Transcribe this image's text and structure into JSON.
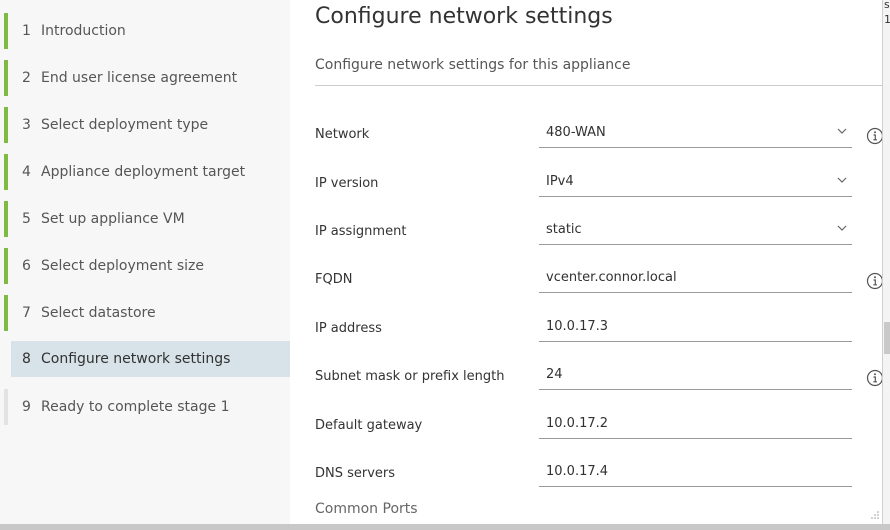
{
  "steps": [
    {
      "num": "1",
      "label": "Introduction",
      "state": "done"
    },
    {
      "num": "2",
      "label": "End user license agreement",
      "state": "done"
    },
    {
      "num": "3",
      "label": "Select deployment type",
      "state": "done"
    },
    {
      "num": "4",
      "label": "Appliance deployment target",
      "state": "done"
    },
    {
      "num": "5",
      "label": "Set up appliance VM",
      "state": "done"
    },
    {
      "num": "6",
      "label": "Select deployment size",
      "state": "done"
    },
    {
      "num": "7",
      "label": "Select datastore",
      "state": "done"
    },
    {
      "num": "8",
      "label": "Configure network settings",
      "state": "active"
    },
    {
      "num": "9",
      "label": "Ready to complete stage 1",
      "state": "todo"
    }
  ],
  "main": {
    "title": "Configure network settings",
    "subtitle": "Configure network settings for this appliance",
    "common_ports": "Common Ports"
  },
  "form": {
    "network": {
      "label": "Network",
      "value": "480-WAN"
    },
    "ip_version": {
      "label": "IP version",
      "value": "IPv4"
    },
    "ip_assignment": {
      "label": "IP assignment",
      "value": "static"
    },
    "fqdn": {
      "label": "FQDN",
      "value": "vcenter.connor.local"
    },
    "ip_address": {
      "label": "IP address",
      "value": "10.0.17.3"
    },
    "subnet": {
      "label": "Subnet mask or prefix length",
      "value": "24"
    },
    "gateway": {
      "label": "Default gateway",
      "value": "10.0.17.2"
    },
    "dns": {
      "label": "DNS servers",
      "value": "10.0.17.4"
    }
  },
  "right_edge": {
    "t1": "s",
    "t2": "1"
  },
  "colors": {
    "done_bar": "#7fba42",
    "active_bg": "#d8e3e9"
  }
}
